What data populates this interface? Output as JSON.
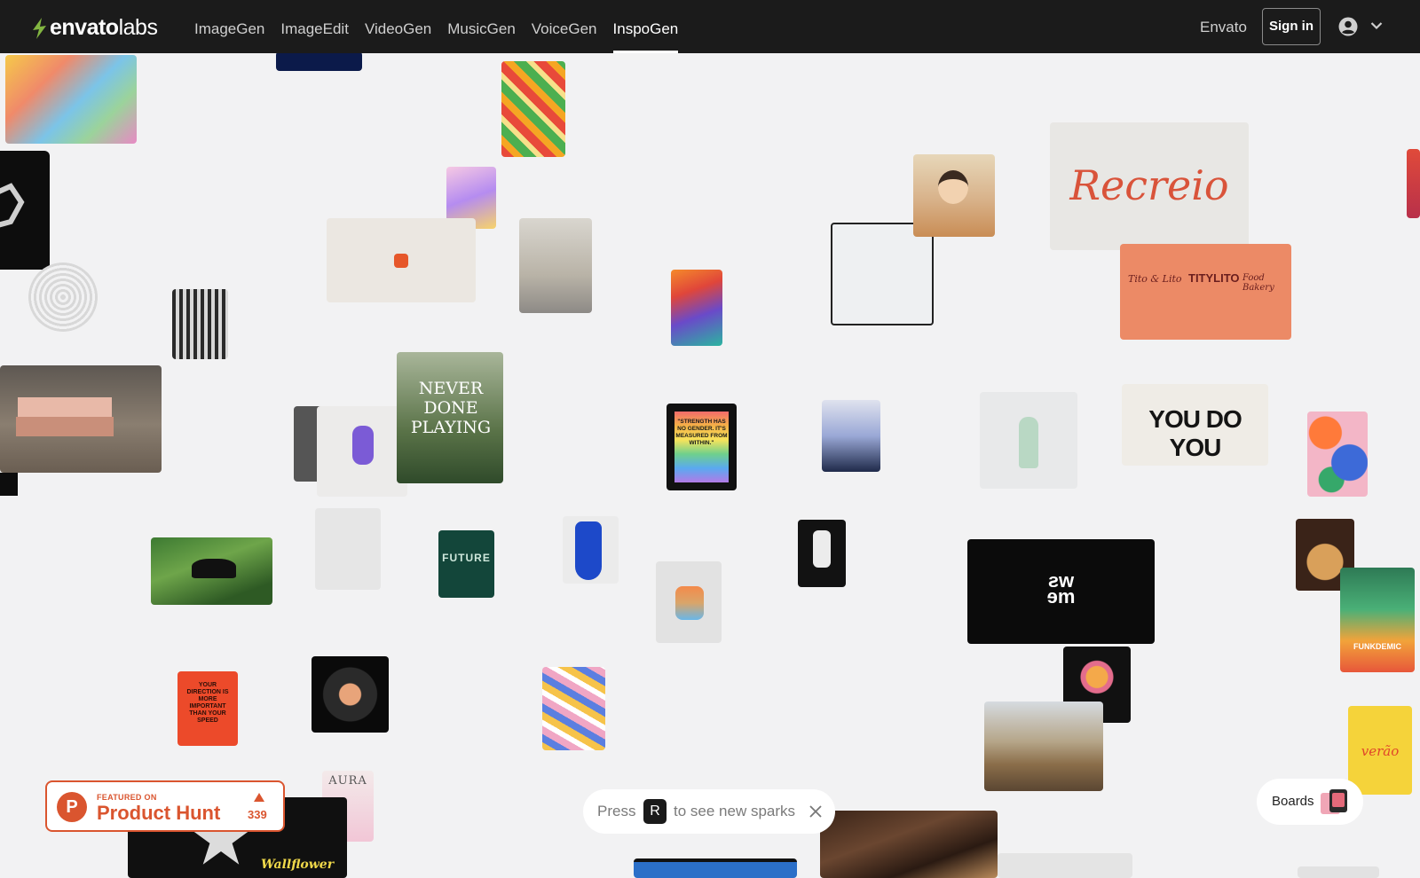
{
  "header": {
    "logo_bold": "envato",
    "logo_light": "labs",
    "nav": [
      {
        "label": "ImageGen"
      },
      {
        "label": "ImageEdit"
      },
      {
        "label": "VideoGen"
      },
      {
        "label": "MusicGen"
      },
      {
        "label": "VoiceGen"
      },
      {
        "label": "InspoGen"
      }
    ],
    "active_nav": "InspoGen",
    "envato_link": "Envato",
    "signin_label": "Sign in",
    "user_icon": "user-circle-icon",
    "menu_icon": "chevron-down-icon"
  },
  "cards": {
    "recreio": "Recreio",
    "tito_lito": "Tito & Lito",
    "titylito": "TITYLITO",
    "food_bakery": "Food Bakery",
    "you_do_you": "YOU DO YOU",
    "never_done_playing": "NEVER DONE PLAYING",
    "strength_quote": "\"STRENGTH HAS NO GENDER. IT'S MEASURED FROM WITHIN.\"",
    "your_direction": "YOUR DIRECTION IS MORE IMPORTANT THAN YOUR SPEED",
    "future": "FUTURE",
    "aura": "AURA",
    "wallflower": "Wallflower",
    "funkdemic": "FUNKDEMIC",
    "verano": "verão",
    "swsm": "ƨw\nɘm"
  },
  "product_hunt": {
    "featured_on": "FEATURED ON",
    "name": "Product Hunt",
    "count": "339",
    "icon": "upvote-arrow-icon"
  },
  "toast": {
    "press": "Press",
    "key": "R",
    "rest": "to see new sparks",
    "close_icon": "close-icon"
  },
  "boards": {
    "label": "Boards"
  },
  "colors": {
    "topbar": "#1b1b1b",
    "canvas": "#f2f2f3",
    "logo_green": "#82b541",
    "product_hunt": "#da552f"
  }
}
